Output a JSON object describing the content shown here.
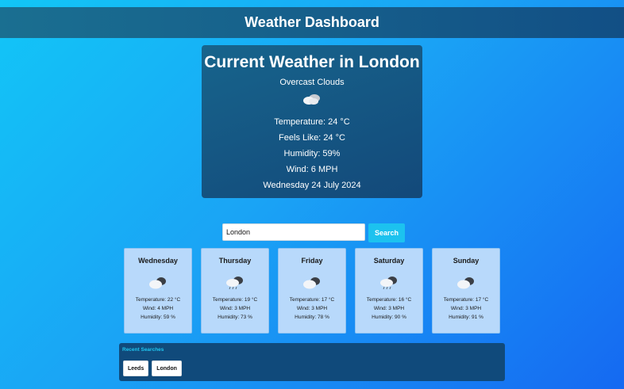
{
  "header": {
    "title": "Weather Dashboard"
  },
  "current": {
    "title": "Current Weather in London",
    "description": "Overcast Clouds",
    "icon": "overcast-clouds-icon",
    "temperature": "Temperature: 24 °C",
    "feels_like": "Feels Like: 24 °C",
    "humidity": "Humidity: 59%",
    "wind": "Wind: 6 MPH",
    "date": "Wednesday 24 July 2024"
  },
  "search": {
    "value": "London",
    "button": "Search"
  },
  "forecast": [
    {
      "day": "Wednesday",
      "icon": "broken-clouds-icon",
      "temperature": "Temperature: 22 °C",
      "wind": "Wind: 4 MPH",
      "humidity": "Humidity: 59 %"
    },
    {
      "day": "Thursday",
      "icon": "rain-icon",
      "temperature": "Temperature: 19 °C",
      "wind": "Wind: 3 MPH",
      "humidity": "Humidity: 73 %"
    },
    {
      "day": "Friday",
      "icon": "broken-clouds-icon",
      "temperature": "Temperature: 17 °C",
      "wind": "Wind: 3 MPH",
      "humidity": "Humidity: 78 %"
    },
    {
      "day": "Saturday",
      "icon": "rain-icon",
      "temperature": "Temperature: 16 °C",
      "wind": "Wind: 3 MPH",
      "humidity": "Humidity: 90 %"
    },
    {
      "day": "Sunday",
      "icon": "broken-clouds-icon",
      "temperature": "Temperature: 17 °C",
      "wind": "Wind: 3 MPH",
      "humidity": "Humidity: 91 %"
    }
  ],
  "recent": {
    "title": "Recent Searches",
    "items": [
      "Leeds",
      "London"
    ]
  }
}
